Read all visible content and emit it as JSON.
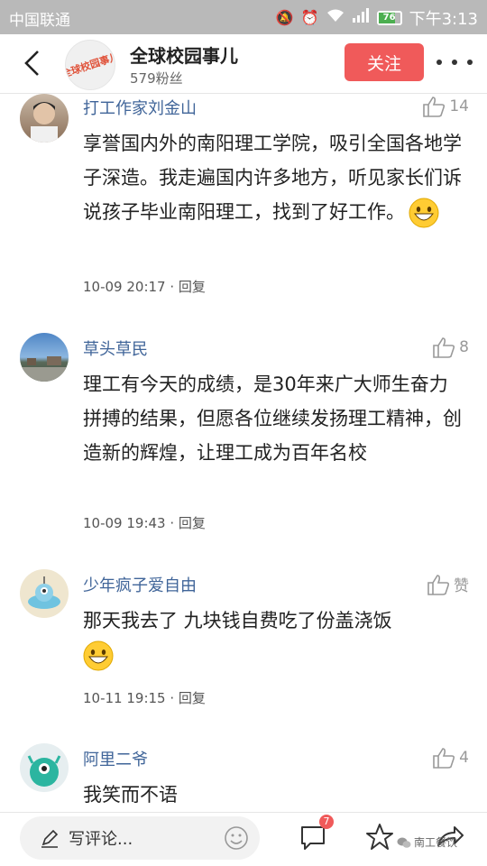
{
  "status_bar": {
    "carrier": "中国联通",
    "battery": "76",
    "time": "下午3:13"
  },
  "header": {
    "logo_text": "全球校园事儿",
    "channel_name": "全球校园事儿",
    "fans": "579粉丝",
    "follow_label": "关注"
  },
  "comments": [
    {
      "name": "打工作家刘金山",
      "likes": "14",
      "text": "享誉国内外的南阳理工学院，吸引全国各地学子深造。我走遍国内许多地方，听见家长们诉说孩子毕业南阳理工，找到了好工作。",
      "emoji": true,
      "time": "10-09 20:17",
      "reply": "回复"
    },
    {
      "name": "草头草民",
      "likes": "8",
      "text": "理工有今天的成绩，是30年来广大师生奋力拼搏的结果，但愿各位继续发扬理工精神，创造新的辉煌，让理工成为百年名校",
      "emoji": false,
      "time": "10-09 19:43",
      "reply": "回复"
    },
    {
      "name": "少年疯子爱自由",
      "likes": "赞",
      "text": "那天我去了 九块钱自费吃了份盖浇饭",
      "emoji": true,
      "time": "10-11 19:15",
      "reply": "回复"
    },
    {
      "name": "阿里二爷",
      "likes": "4",
      "text": "我笑而不语",
      "emoji": false,
      "time": "",
      "reply": ""
    }
  ],
  "bottom_bar": {
    "comment_placeholder": "写评论...",
    "comment_badge": "7",
    "watermark": "南工餐饮"
  },
  "colors": {
    "accent": "#f05a5a",
    "username": "#406599",
    "status_bar": "#b9b9b9"
  }
}
